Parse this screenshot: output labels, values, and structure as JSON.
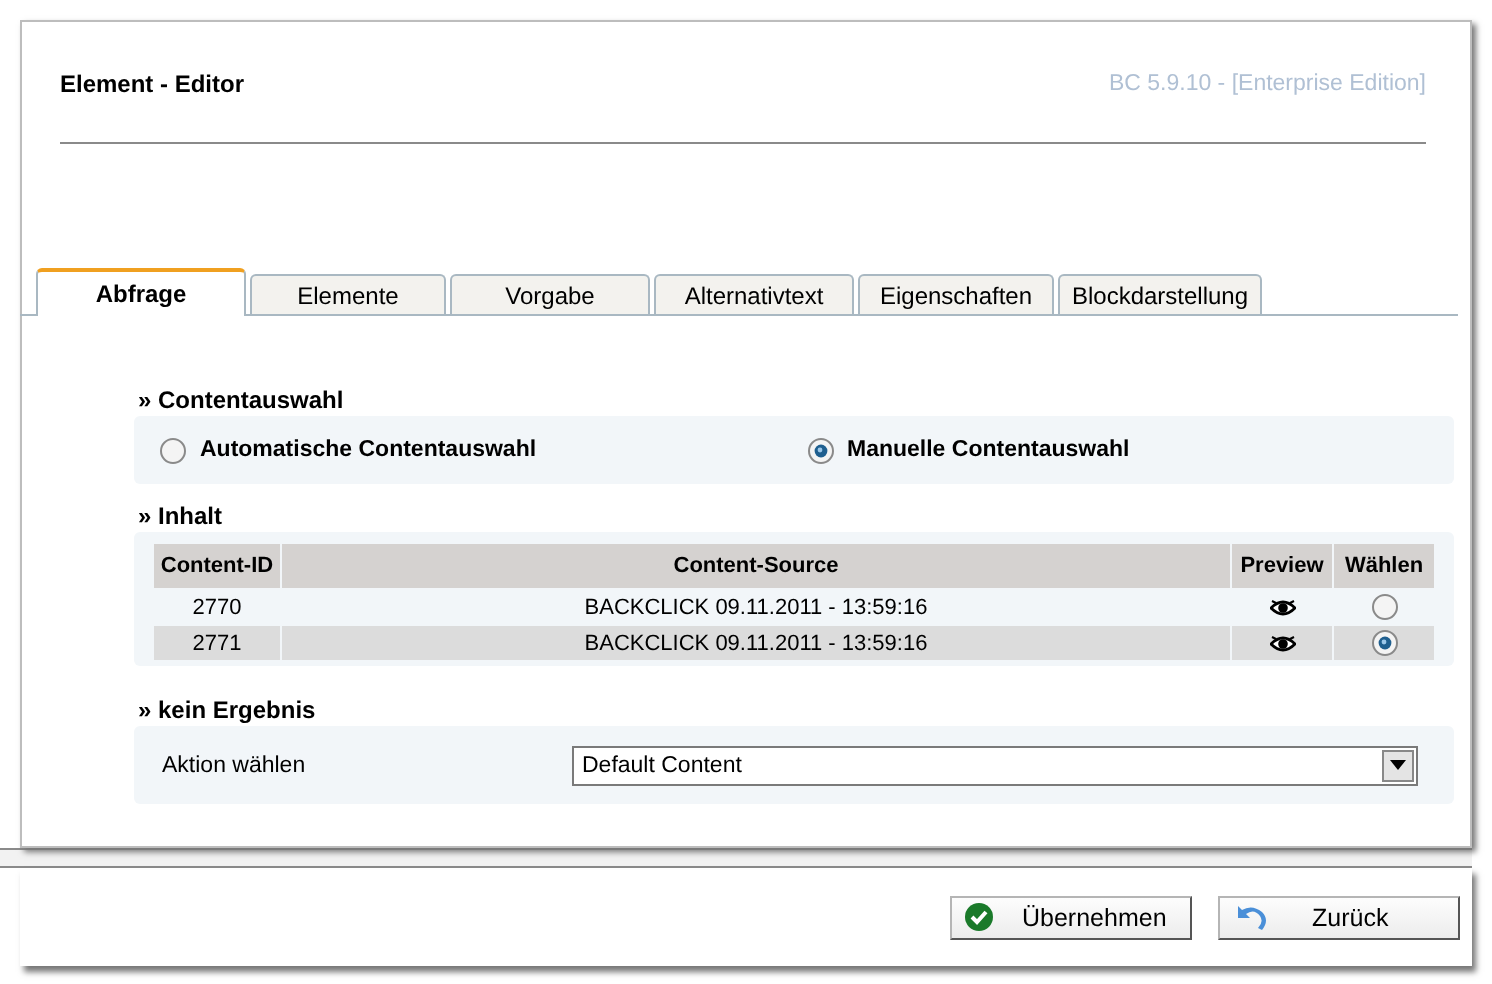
{
  "header": {
    "title": "Element - Editor",
    "version": "BC 5.9.10 - [Enterprise Edition]"
  },
  "tabs": [
    {
      "label": "Abfrage",
      "selected": true
    },
    {
      "label": "Elemente",
      "selected": false
    },
    {
      "label": "Vorgabe",
      "selected": false
    },
    {
      "label": "Alternativtext",
      "selected": false
    },
    {
      "label": "Eigenschaften",
      "selected": false
    },
    {
      "label": "Blockdarstellung",
      "selected": false
    }
  ],
  "content_selection": {
    "heading": "» Contentauswahl",
    "options": [
      {
        "label": "Automatische Contentauswahl",
        "selected": false
      },
      {
        "label": "Manuelle Contentauswahl",
        "selected": true
      }
    ]
  },
  "content": {
    "heading": "» Inhalt",
    "columns": [
      "Content-ID",
      "Content-Source",
      "Preview",
      "Wählen"
    ],
    "rows": [
      {
        "id": "2770",
        "source": "BACKCLICK 09.11.2011 - 13:59:16",
        "selected": false
      },
      {
        "id": "2771",
        "source": "BACKCLICK 09.11.2011 - 13:59:16",
        "selected": true
      }
    ]
  },
  "no_result": {
    "heading": "» kein Ergebnis",
    "label": "Aktion wählen",
    "value": "Default Content"
  },
  "buttons": [
    {
      "label": "Übernehmen",
      "kind": "apply"
    },
    {
      "label": "Zurück",
      "kind": "back"
    }
  ]
}
